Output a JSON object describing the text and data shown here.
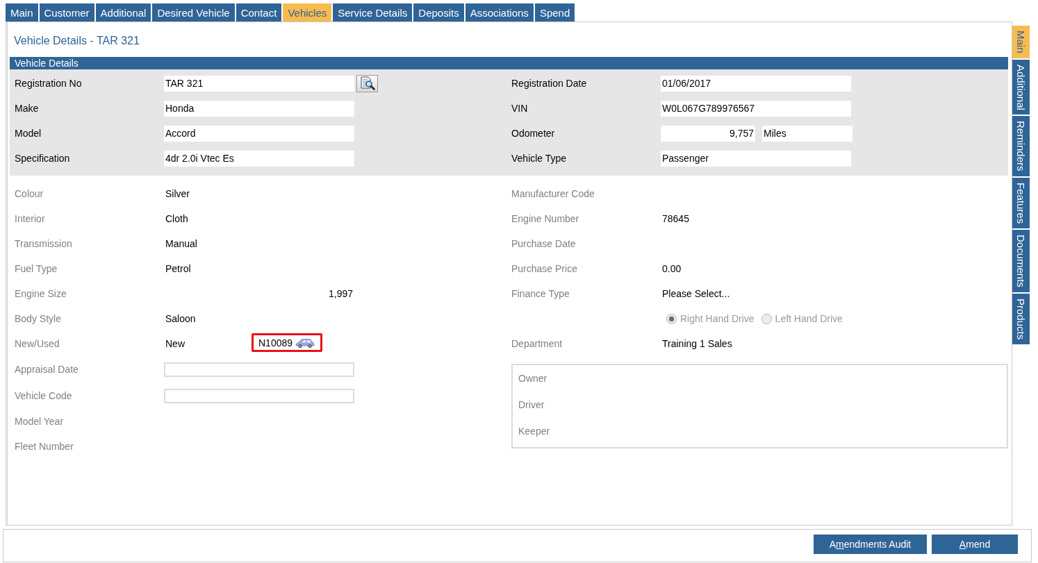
{
  "tabs": [
    {
      "label": "Main",
      "selected": false
    },
    {
      "label": "Customer",
      "selected": false
    },
    {
      "label": "Additional",
      "selected": false
    },
    {
      "label": "Desired Vehicle",
      "selected": false
    },
    {
      "label": "Contact",
      "selected": false
    },
    {
      "label": "Vehicles",
      "selected": true
    },
    {
      "label": "Service Details",
      "selected": false
    },
    {
      "label": "Deposits",
      "selected": false
    },
    {
      "label": "Associations",
      "selected": false
    },
    {
      "label": "Spend",
      "selected": false
    }
  ],
  "page_title": "Vehicle Details - TAR 321",
  "section_header": "Vehicle Details",
  "key_fields": {
    "left": [
      {
        "label": "Registration No",
        "value": "TAR 321",
        "kind": "lookup"
      },
      {
        "label": "Make",
        "value": "Honda",
        "kind": "input"
      },
      {
        "label": "Model",
        "value": "Accord",
        "kind": "input"
      },
      {
        "label": "Specification",
        "value": "4dr 2.0i Vtec Es",
        "kind": "input"
      }
    ],
    "right": [
      {
        "label": "Registration Date",
        "value": "01/06/2017",
        "kind": "input"
      },
      {
        "label": "VIN",
        "value": "W0L067G789976567",
        "kind": "input"
      },
      {
        "label": "Odometer",
        "value": "9,757",
        "unit": "Miles",
        "kind": "measure"
      },
      {
        "label": "Vehicle Type",
        "value": "Passenger",
        "kind": "input"
      }
    ]
  },
  "details": {
    "left": [
      {
        "label": "Colour",
        "value": "Silver",
        "kind": "text"
      },
      {
        "label": "Interior",
        "value": "Cloth",
        "kind": "text"
      },
      {
        "label": "Transmission",
        "value": "Manual",
        "kind": "text"
      },
      {
        "label": "Fuel Type",
        "value": "Petrol",
        "kind": "text"
      },
      {
        "label": "Engine Size",
        "value": "1,997",
        "kind": "number"
      },
      {
        "label": "Body Style",
        "value": "Saloon",
        "kind": "text"
      },
      {
        "label": "New/Used",
        "value": "New",
        "kind": "stock",
        "stock_number": "N10089",
        "highlighted": true
      },
      {
        "label": "Appraisal Date",
        "kind": "input"
      },
      {
        "label": "Vehicle Code",
        "kind": "input"
      },
      {
        "label": "Model Year",
        "kind": "text"
      },
      {
        "label": "Fleet Number",
        "kind": "text"
      }
    ],
    "right": [
      {
        "label": "Manufacturer Code",
        "kind": "text"
      },
      {
        "label": "Engine Number",
        "value": "78645",
        "kind": "text"
      },
      {
        "label": "Purchase Date",
        "kind": "text"
      },
      {
        "label": "Purchase Price",
        "value": "0.00",
        "kind": "text"
      },
      {
        "label": "Finance Type",
        "value": "Please Select...",
        "kind": "text"
      },
      {
        "kind": "radio_group",
        "disabled": true,
        "options": [
          {
            "label": "Right Hand Drive",
            "selected": true
          },
          {
            "label": "Left Hand Drive",
            "selected": false
          }
        ]
      },
      {
        "label": "Department",
        "value": "Training 1 Sales",
        "kind": "text"
      }
    ]
  },
  "parties": [
    "Owner",
    "Driver",
    "Keeper"
  ],
  "side_tabs": [
    {
      "label": "Main",
      "selected": true
    },
    {
      "label": "Additional",
      "selected": false
    },
    {
      "label": "Reminders",
      "selected": false
    },
    {
      "label": "Features",
      "selected": false
    },
    {
      "label": "Documents",
      "selected": false
    },
    {
      "label": "Products",
      "selected": false
    }
  ],
  "buttons": [
    {
      "prefix": "A",
      "access_key": "m",
      "suffix": "endments Audit"
    },
    {
      "access_key": "A",
      "suffix": "mend"
    }
  ]
}
